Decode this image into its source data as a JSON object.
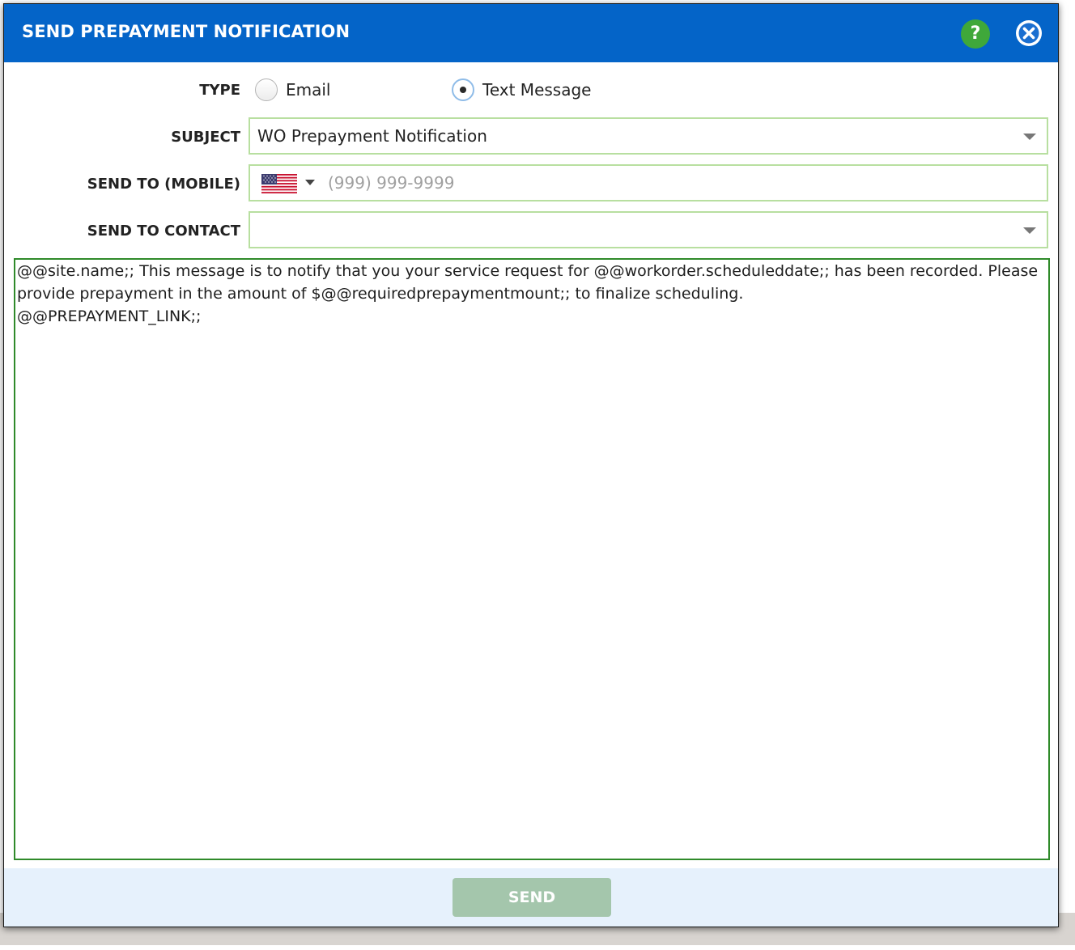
{
  "dialog": {
    "title": "SEND PREPAYMENT NOTIFICATION",
    "help_label": "?",
    "help_icon": "help-icon",
    "close_icon": "close-icon",
    "header_color": "#0464c8",
    "help_color": "#3fa83a"
  },
  "form": {
    "type_label": "TYPE",
    "type_options": [
      {
        "label": "Email",
        "checked": false
      },
      {
        "label": "Text Message",
        "checked": true
      }
    ],
    "subject_label": "SUBJECT",
    "subject_value": "WO Prepayment Notification",
    "send_to_label": "SEND TO (MOBILE)",
    "country_flag": "us-flag-icon",
    "phone_value": "",
    "phone_placeholder": "(999) 999-9999",
    "contact_label": "SEND TO CONTACT",
    "contact_value": "",
    "field_border_color": "#b8dfa0"
  },
  "message": {
    "text": "@@site.name;; This message is to notify that you your service request for @@workorder.scheduleddate;; has been recorded. Please provide prepayment in the amount of $@@requiredprepaymentmount;; to finalize scheduling.\n@@PREPAYMENT_LINK;;",
    "border_color": "#2f8a2a"
  },
  "footer": {
    "send_label": "SEND",
    "send_color": "#a4c6ac"
  }
}
